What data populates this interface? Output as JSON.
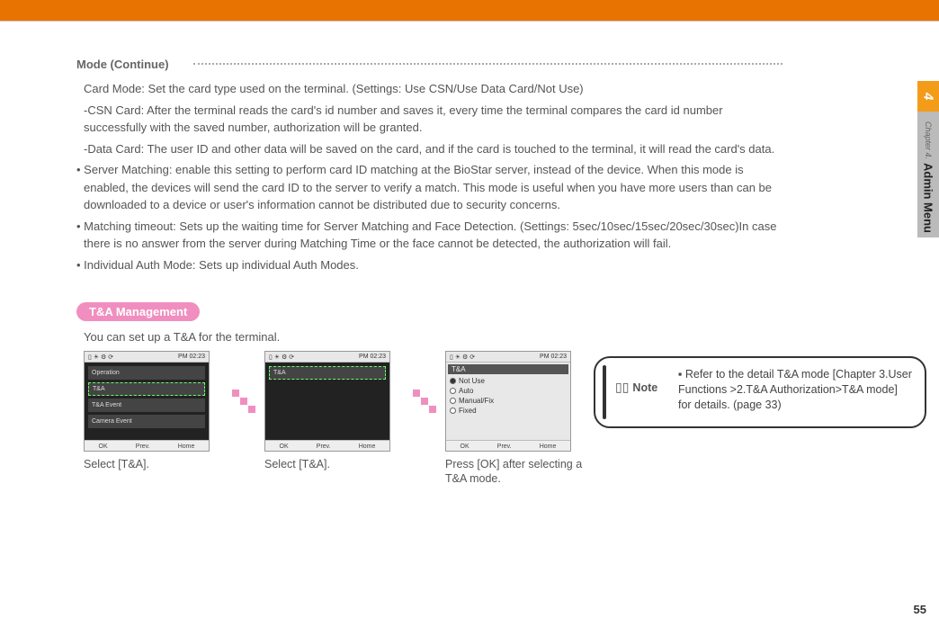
{
  "side_tab": {
    "chapter_num": "4",
    "chapter_label": "Chapter 4.",
    "section": "Admin Menu"
  },
  "page_number": "55",
  "mode_continue_header": "Mode (Continue)",
  "paragraphs": {
    "card_mode": "Card Mode: Set the card type used on the terminal. (Settings: Use CSN/Use Data Card/Not Use)",
    "csn_card": "-CSN Card: After the terminal reads the card's id number and saves it, every time the terminal compares the card id number successfully with the saved number, authorization will be granted.",
    "data_card": "-Data Card: The user ID and other data will be saved on the card, and if the card is touched to the terminal, it will read the card's data.",
    "server_matching": "Server Matching: enable this setting to perform card ID matching at the BioStar server, instead of the device. When this mode is enabled, the devices will send the card ID to the server to verify a match. This mode is useful when you have more users than can be downloaded to a device or user's information cannot be distributed due to security concerns.",
    "matching_timeout": "Matching timeout: Sets up the waiting time for Server Matching and Face Detection. (Settings: 5sec/10sec/15sec/20sec/30sec)In case there is no answer from the server during Matching Time or the face cannot be detected, the authorization will fail.",
    "individual_auth": "Individual Auth Mode: Sets up individual Auth Modes."
  },
  "tna_pill": "T&A Management",
  "tna_intro": "You can set up a T&A for the terminal.",
  "steps": {
    "s1_caption": "Select [T&A].",
    "s2_caption": "Select [T&A].",
    "s3_caption": "Press [OK] after selecting a T&A mode."
  },
  "screens": {
    "time": "PM 02:23",
    "s1_items": [
      "Operation",
      "T&A",
      "T&A Event",
      "Camera Event"
    ],
    "s2_items": [
      "T&A"
    ],
    "s3_title": "T&A",
    "s3_options": [
      "Not Use",
      "Auto",
      "Manual/Fix",
      "Fixed"
    ],
    "bottom_buttons": [
      "OK",
      "Prev.",
      "Home"
    ]
  },
  "note": {
    "label": "Note",
    "text": "Refer to the detail T&A mode [Chapter 3.User Functions >2.T&A Authorization>T&A mode] for details. (page 33)"
  }
}
